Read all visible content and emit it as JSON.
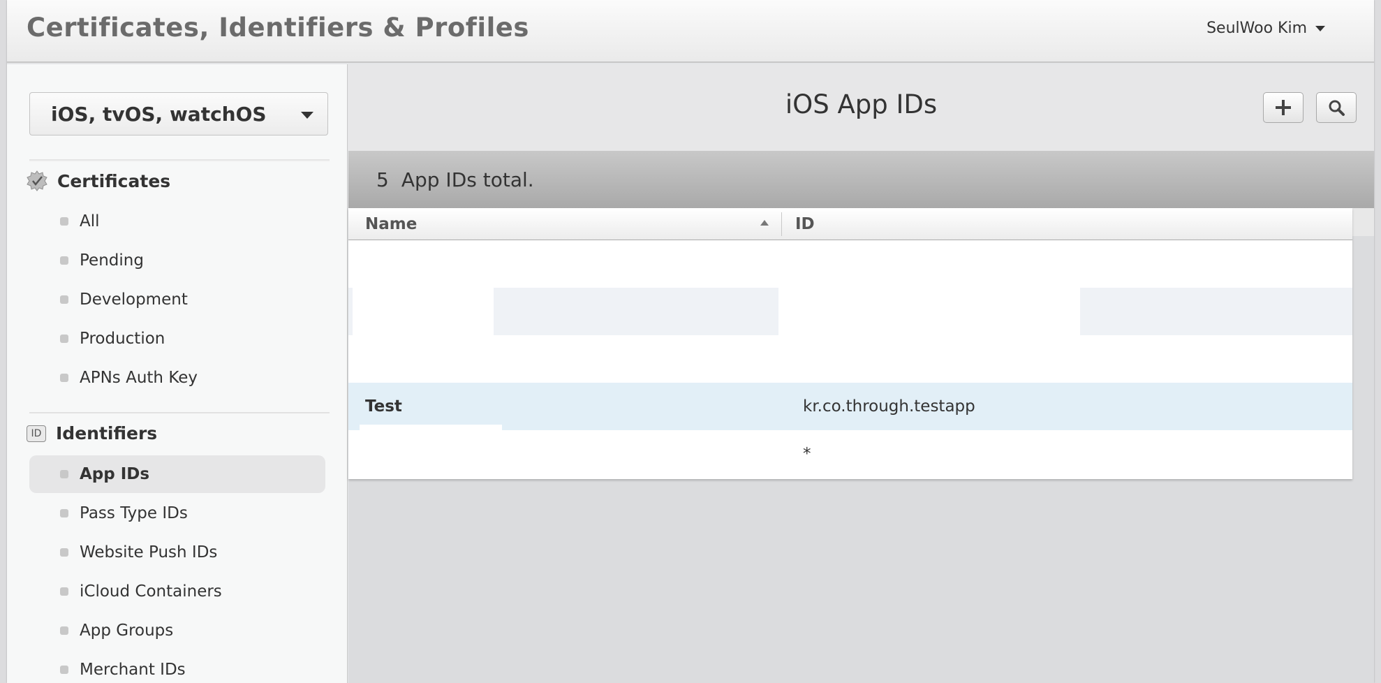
{
  "header": {
    "title": "Certificates, Identifiers & Profiles",
    "user_name": "SeulWoo Kim"
  },
  "sidebar": {
    "platform": "iOS, tvOS, watchOS",
    "certificates": {
      "heading": "Certificates",
      "items": [
        "All",
        "Pending",
        "Development",
        "Production",
        "APNs Auth Key"
      ]
    },
    "identifiers": {
      "heading": "Identifiers",
      "icon_text": "ID",
      "items": [
        "App IDs",
        "Pass Type IDs",
        "Website Push IDs",
        "iCloud Containers",
        "App Groups",
        "Merchant IDs"
      ],
      "active": "App IDs"
    }
  },
  "main": {
    "title": "iOS App IDs",
    "count": "5",
    "count_label": "App IDs total.",
    "columns": {
      "name": "Name",
      "id": "ID"
    },
    "rows": [
      {
        "name": "",
        "id": ""
      },
      {
        "name": "",
        "id": ""
      },
      {
        "name": "",
        "id": ""
      },
      {
        "name": "Test",
        "id": "kr.co.through.testapp"
      },
      {
        "name": "",
        "id": "*"
      }
    ]
  },
  "icons": {
    "add": "plus-icon",
    "search": "search-icon",
    "certificate": "certificate-badge-icon",
    "identifier": "id-badge-icon"
  },
  "colors": {
    "highlight_row": "#e2eff7",
    "active_nav": "#e6e6e7"
  }
}
